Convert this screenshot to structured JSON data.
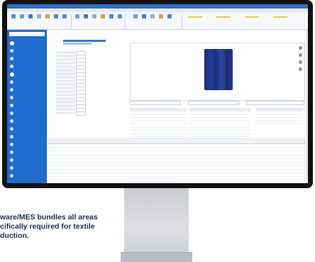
{
  "caption": {
    "line1": "ware/MES bundles all areas",
    "line2": "cifically required for textile",
    "line3": "duction."
  },
  "app": {
    "title": "",
    "tabs": [
      "",
      "",
      "",
      "",
      "",
      ""
    ],
    "ribbon_buttons": 18
  },
  "sidebar": {
    "items": [
      {
        "label": "",
        "icon": "home-icon",
        "head": true
      },
      {
        "label": "",
        "icon": "list-icon"
      },
      {
        "label": "",
        "icon": "list-icon"
      },
      {
        "label": "",
        "icon": "list-icon"
      },
      {
        "label": "",
        "icon": "menu-icon",
        "head": true
      },
      {
        "label": "",
        "icon": "item-icon"
      },
      {
        "label": "",
        "icon": "item-icon"
      },
      {
        "label": "",
        "icon": "item-icon"
      },
      {
        "label": "",
        "icon": "item-icon"
      },
      {
        "label": "",
        "icon": "item-icon"
      },
      {
        "label": "",
        "icon": "item-icon"
      },
      {
        "label": "",
        "icon": "item-icon"
      },
      {
        "label": "",
        "icon": "item-icon"
      },
      {
        "label": "",
        "icon": "item-icon"
      },
      {
        "label": "",
        "icon": "item-icon"
      },
      {
        "label": "",
        "icon": "item-icon"
      },
      {
        "label": "",
        "icon": "item-icon"
      },
      {
        "label": "",
        "icon": "item-icon"
      }
    ]
  },
  "colors": {
    "sidebar": "#1f6bd0",
    "titlebar": "#2d6fc4",
    "fabric": "#1d338a",
    "caption": "#1e2b57"
  },
  "form_rows": 18,
  "grid_rows": 12
}
